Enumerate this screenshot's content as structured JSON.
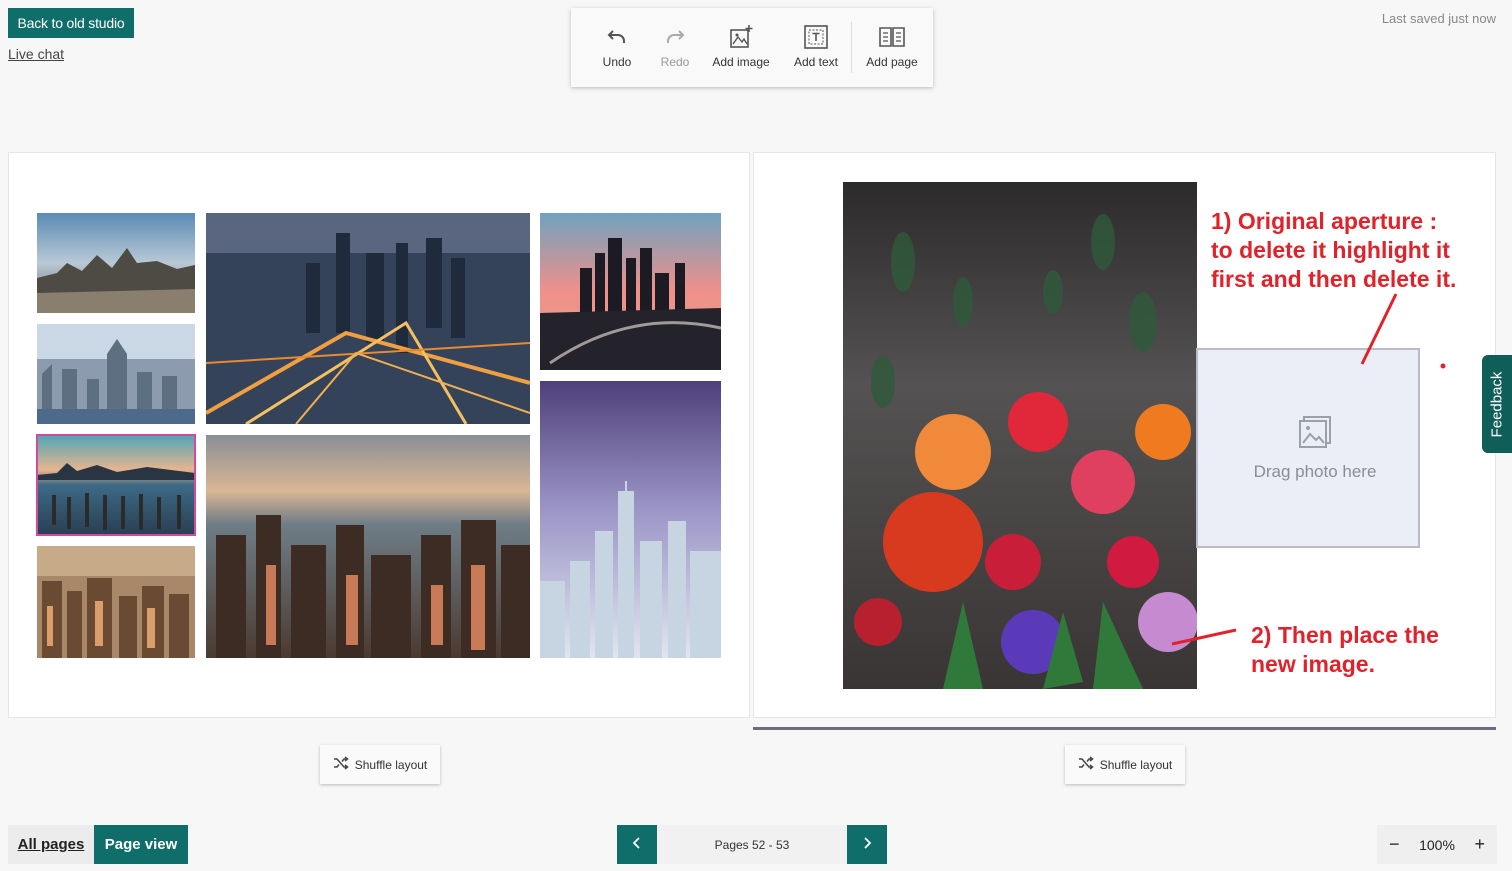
{
  "header": {
    "back_label": "Back to old studio",
    "live_chat": "Live chat",
    "last_saved": "Last saved just now"
  },
  "toolbar": {
    "undo": "Undo",
    "redo": "Redo",
    "add_image": "Add image",
    "add_text": "Add text",
    "add_page": "Add page"
  },
  "canvas": {
    "drop_zone_label": "Drag photo here",
    "annotation_1": [
      "1) Original aperture :",
      "to delete it highlight it",
      "first and then delete it."
    ],
    "annotation_2": [
      "2) Then place the",
      "new image."
    ]
  },
  "feedback": "Feedback",
  "shuffle_left": "Shuffle layout",
  "shuffle_right": "Shuffle layout",
  "footer": {
    "all_pages": "All pages",
    "page_view": "Page view",
    "pages_label": "Pages 52 - 53",
    "zoom": "100%",
    "zoom_out": "−",
    "zoom_in": "+"
  },
  "colors": {
    "brand": "#0f6e6a",
    "annotation": "#e0232b",
    "selection": "#d04aa0"
  }
}
